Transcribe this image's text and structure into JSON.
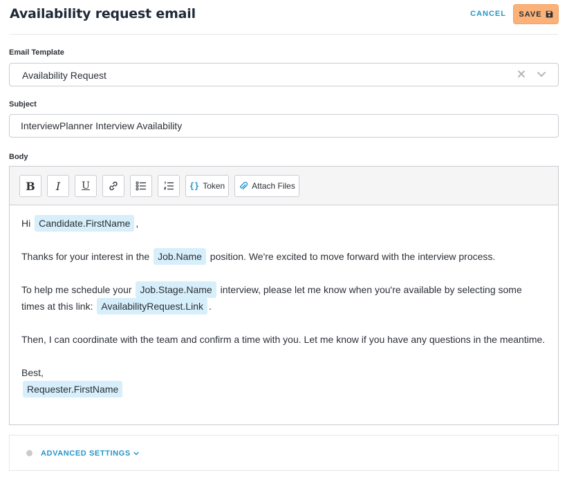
{
  "header": {
    "title": "Availability request email",
    "cancel_label": "CANCEL",
    "save_label": "SAVE",
    "save_icon": "floppy-disk-icon"
  },
  "template_field": {
    "label": "Email Template",
    "value": "Availability Request"
  },
  "subject_field": {
    "label": "Subject",
    "value": "InterviewPlanner Interview Availability"
  },
  "body_field": {
    "label": "Body",
    "toolbar": {
      "bold": "B",
      "italic": "I",
      "underline": "U",
      "token_label": "Token",
      "attach_label": "Attach Files"
    },
    "content": {
      "greeting_prefix": "Hi",
      "greeting_token": "Candidate.FirstName",
      "greeting_suffix": ",",
      "p1_prefix": "Thanks for your interest in the",
      "p1_token": "Job.Name",
      "p1_suffix": "position. We're excited to move forward with the interview process.",
      "p2_prefix": "To help me schedule your",
      "p2_token": "Job.Stage.Name",
      "p2_middle": "interview, please let me know when you're available by selecting some times at this link:",
      "p2_token2": "AvailabilityRequest.Link",
      "p2_suffix": ".",
      "p3": "Then, I can coordinate with the team and confirm a time with you. Let me know if you have any questions in the meantime.",
      "signoff": "Best,",
      "signature_token": "Requester.FirstName"
    }
  },
  "advanced": {
    "label": "ADVANCED SETTINGS"
  },
  "colors": {
    "accent": "#2296c9",
    "save_button": "#fbb178",
    "token_bg": "#d6effb"
  }
}
